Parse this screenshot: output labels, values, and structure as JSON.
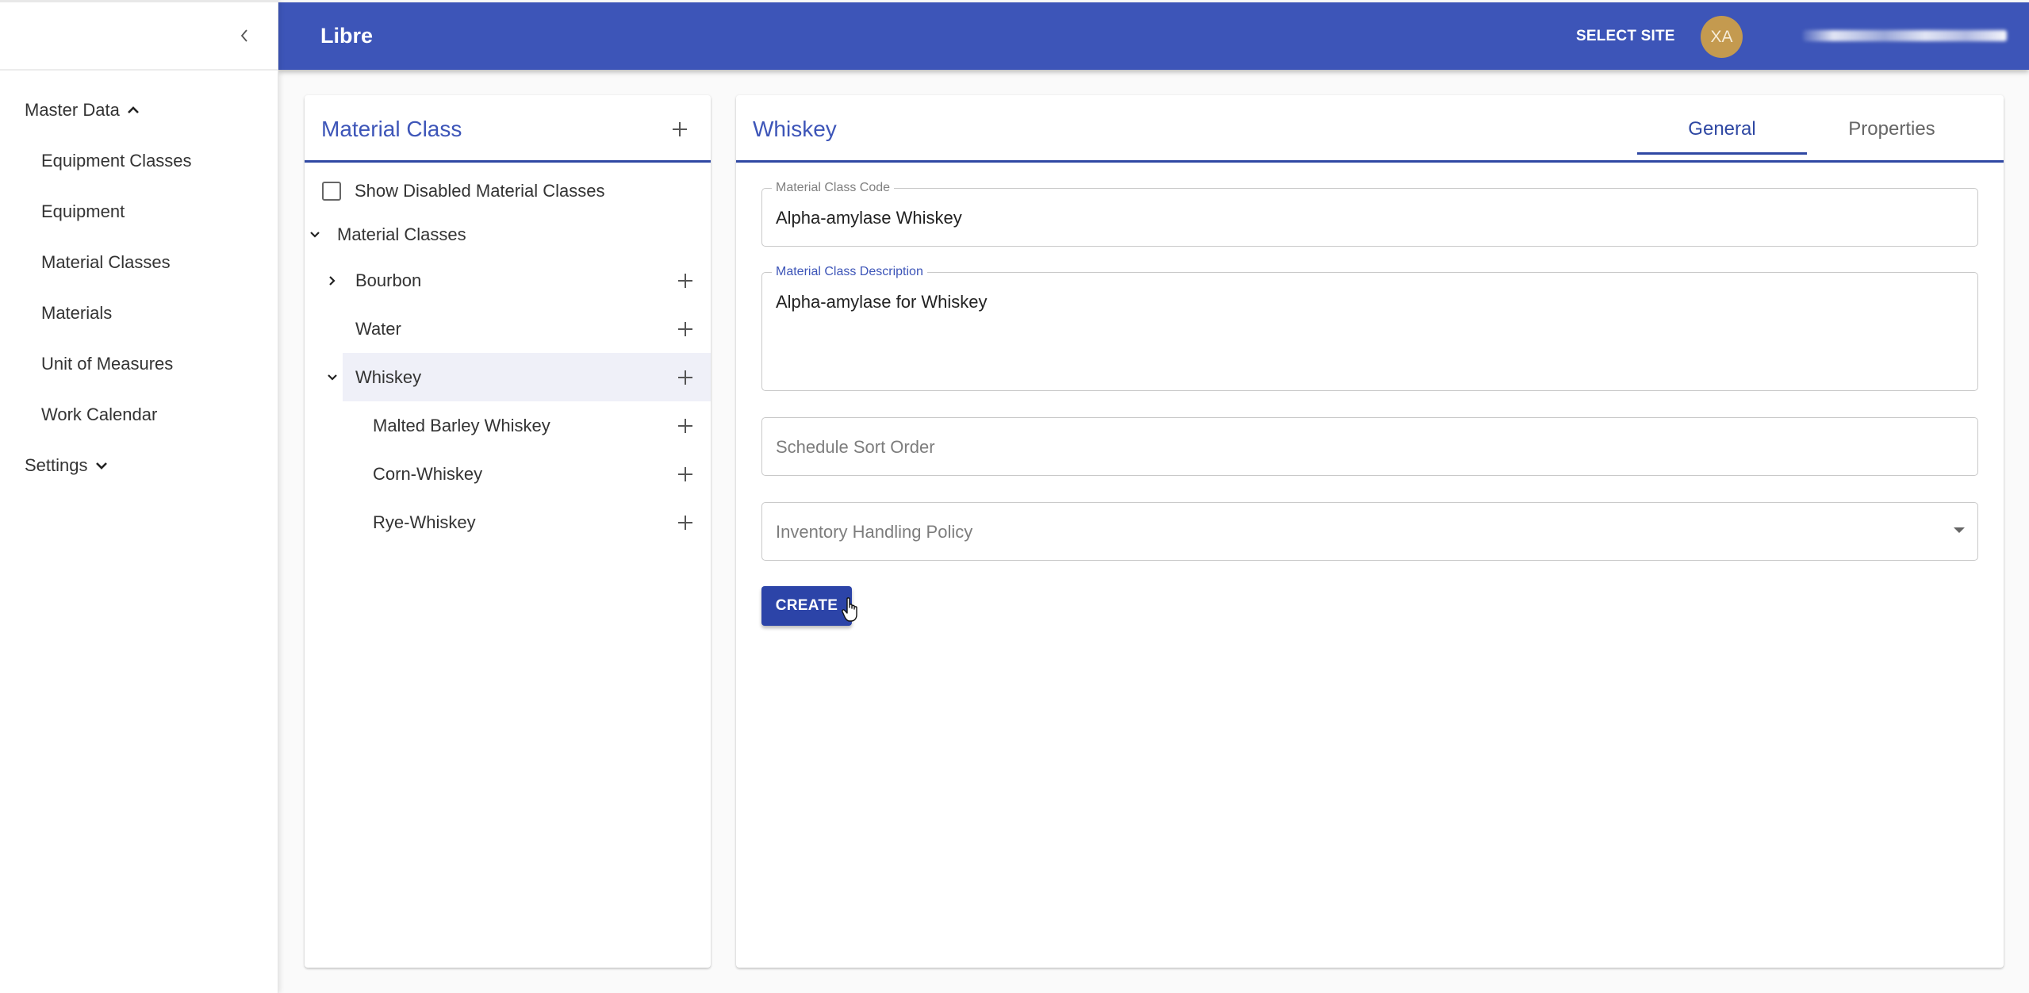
{
  "sidebar": {
    "collapse_icon": "chevron-left-icon",
    "groups": [
      {
        "label": "Master Data",
        "expanded": true,
        "icon": "chevron-up-icon",
        "items": [
          {
            "label": "Equipment Classes"
          },
          {
            "label": "Equipment"
          },
          {
            "label": "Material Classes"
          },
          {
            "label": "Materials"
          },
          {
            "label": "Unit of Measures"
          },
          {
            "label": "Work Calendar"
          }
        ]
      },
      {
        "label": "Settings",
        "expanded": false,
        "icon": "chevron-down-icon",
        "items": []
      }
    ]
  },
  "header": {
    "app_title": "Libre",
    "select_site_label": "SELECT SITE",
    "avatar_initials": "XA",
    "avatar_color": "#c49a4f",
    "brand_color": "#3d55b8"
  },
  "material_class_panel": {
    "title": "Material Class",
    "add_icon": "plus-icon",
    "show_disabled_label": "Show Disabled Material Classes",
    "show_disabled_checked": false,
    "tree": {
      "root": {
        "label": "Material Classes",
        "expanded": true
      },
      "nodes": [
        {
          "label": "Bourbon",
          "expanded": false,
          "has_children": true
        },
        {
          "label": "Water",
          "has_children": false
        },
        {
          "label": "Whiskey",
          "expanded": true,
          "has_children": true,
          "selected": true,
          "children": [
            {
              "label": "Malted Barley Whiskey"
            },
            {
              "label": "Corn-Whiskey"
            },
            {
              "label": "Rye-Whiskey"
            }
          ]
        }
      ]
    }
  },
  "detail_panel": {
    "title": "Whiskey",
    "tabs": [
      {
        "label": "General",
        "active": true
      },
      {
        "label": "Properties",
        "active": false
      }
    ],
    "form": {
      "code": {
        "label": "Material Class Code",
        "value": "Alpha-amylase Whiskey"
      },
      "description": {
        "label": "Material Class Description",
        "value": "Alpha-amylase for Whiskey"
      },
      "schedule_sort_order": {
        "placeholder": "Schedule Sort Order",
        "value": ""
      },
      "inventory_handling_policy": {
        "placeholder": "Inventory Handling Policy",
        "value": ""
      }
    },
    "create_label": "CREATE"
  }
}
